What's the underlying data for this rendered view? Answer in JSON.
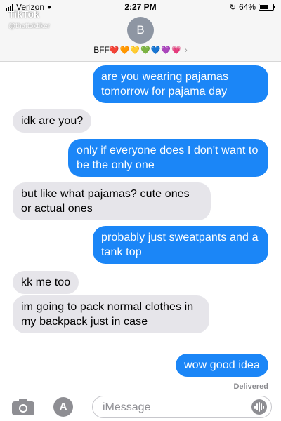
{
  "status_bar": {
    "carrier": "Verizon",
    "time": "2:27 PM",
    "battery": "64%",
    "battery_level": 0.64
  },
  "watermark": {
    "logo": "TikTok",
    "handle": "@thattoktiker"
  },
  "header": {
    "avatar_initial": "B",
    "contact_name": "BFF",
    "contact_hearts": "❤️🧡💛💚💙💜💗"
  },
  "messages": [
    {
      "type": "sent",
      "text": "are you wearing pajamas tomorrow for pajama day"
    },
    {
      "type": "received",
      "text": "idk are you?"
    },
    {
      "type": "sent",
      "text": "only if everyone does I don't want to be the only one"
    },
    {
      "type": "received",
      "text": "but like what pajamas? cute ones or actual ones"
    },
    {
      "type": "sent",
      "text": "probably just sweatpants and a tank top"
    },
    {
      "type": "received",
      "text": "kk me too"
    },
    {
      "type": "received",
      "text": "im going to pack normal clothes in my backpack just in case"
    },
    {
      "type": "sent",
      "text": "wow good idea"
    }
  ],
  "delivered_label": "Delivered",
  "input": {
    "placeholder": "iMessage"
  },
  "colors": {
    "sent_bubble": "#1b86f7",
    "received_bubble": "#e6e5ea"
  }
}
